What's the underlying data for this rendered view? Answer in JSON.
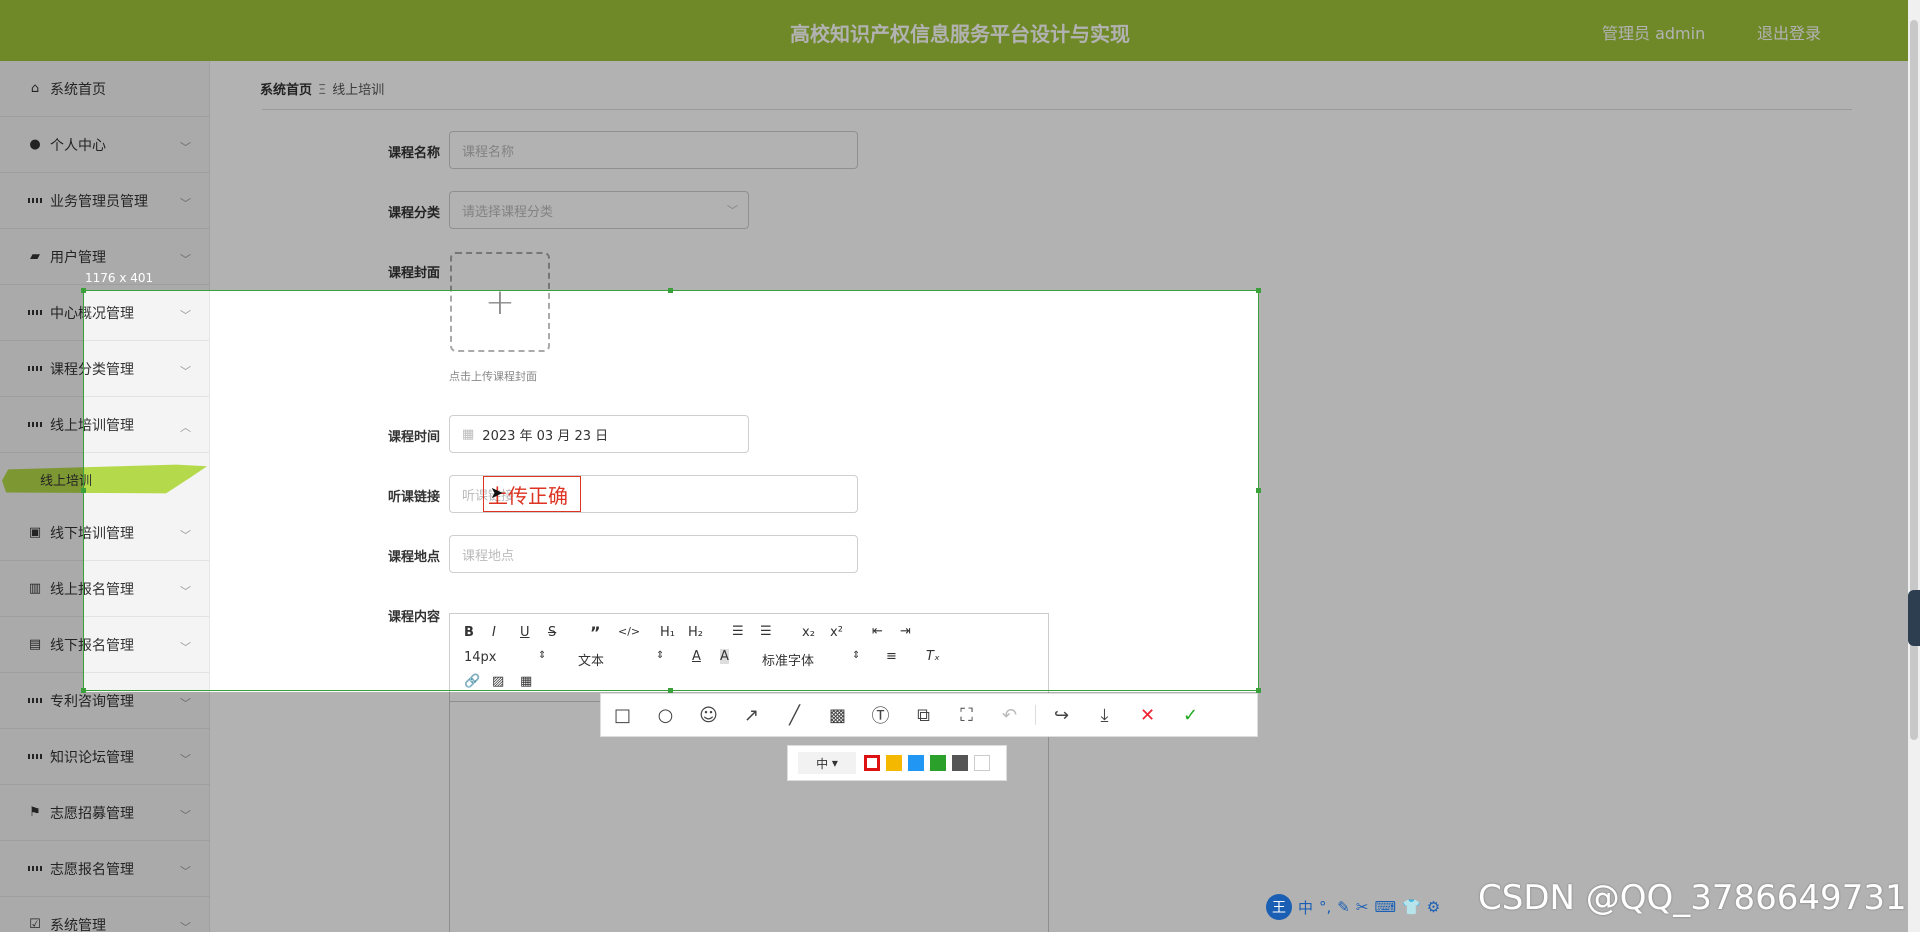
{
  "header": {
    "title": "高校知识产权信息服务平台设计与实现",
    "user": "管理员 admin",
    "logout": "退出登录",
    "bg_color": "#9fc53a"
  },
  "sidebar": {
    "items": [
      {
        "label": "系统首页",
        "icon": "home-icon"
      },
      {
        "label": "个人中心",
        "icon": "person-icon"
      },
      {
        "label": "业务管理员管理",
        "icon": "grid-icon"
      },
      {
        "label": "用户管理",
        "icon": "bag-icon"
      },
      {
        "label": "中心概况管理",
        "icon": "grid-icon"
      },
      {
        "label": "课程分类管理",
        "icon": "grid-icon"
      },
      {
        "label": "线上培训管理",
        "icon": "grid-icon"
      },
      {
        "label": "线下培训管理",
        "icon": "clipboard-icon"
      },
      {
        "label": "线上报名管理",
        "icon": "book-icon"
      },
      {
        "label": "线下报名管理",
        "icon": "briefcase-icon"
      },
      {
        "label": "专利咨询管理",
        "icon": "grid-icon"
      },
      {
        "label": "知识论坛管理",
        "icon": "grid-icon"
      },
      {
        "label": "志愿招募管理",
        "icon": "flag-icon"
      },
      {
        "label": "志愿报名管理",
        "icon": "grid-icon"
      },
      {
        "label": "系统管理",
        "icon": "check-icon"
      }
    ],
    "active_sub": "线上培训",
    "active_color": "#b4d94a"
  },
  "breadcrumb": {
    "home": "系统首页",
    "current": "线上培训"
  },
  "form": {
    "course_name_label": "课程名称",
    "course_name_placeholder": "课程名称",
    "category_label": "课程分类",
    "category_placeholder": "请选择课程分类",
    "cover_label": "课程封面",
    "cover_hint": "点击上传课程封面",
    "time_label": "课程时间",
    "time_value": "2023 年 03 月 23 日",
    "link_label": "听课链接",
    "link_placeholder": "听课链接",
    "location_label": "课程地点",
    "location_placeholder": "课程地点",
    "content_label": "课程内容"
  },
  "editor": {
    "font_size": "14px",
    "block_type": "文本",
    "font_family": "标准字体"
  },
  "screenshot_tool": {
    "size_label": "1176 x 401",
    "annotation_text": "上传正确",
    "pen_size": "中",
    "colors": [
      "#e02020",
      "#f5b800",
      "#2196f3",
      "#2ba02b",
      "#555555",
      "#ffffff"
    ],
    "border_color": "#3aa03a"
  },
  "ime": {
    "mode": "中"
  },
  "watermark": "CSDN @QQ_3786649731"
}
